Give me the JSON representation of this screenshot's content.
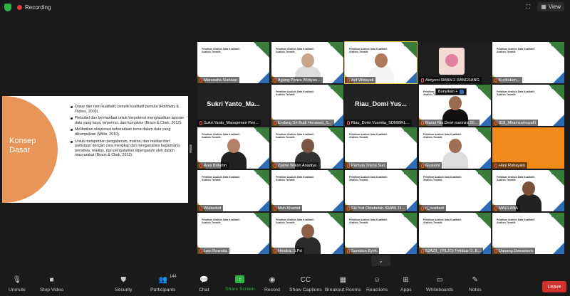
{
  "topbar": {
    "recording": "Recording",
    "view": "View"
  },
  "presentation": {
    "title_line1": "Konsep",
    "title_line2": "Dasar",
    "bullets": [
      "Dasar dari riset kualitatif, peneliti kualitatif pemula (Holloway & Todres, 2003).",
      "Fleksibel dan bermanfaat untuk berpotensi menghasilkan laporan data yang kaya, terperinci, dan kompleks (Braun & Clark, 2012).",
      "Melibatkan eksplorasi keberadaan tema dalam data yang dikumpulkan (Willis, 2010).",
      "Untuk melaporkan pengalaman, makna, dan realitas dari partisipan dengan cara mengkaji dan menganalisis bagaimana peristiwa, realitas, dan pengalaman dipengaruhi oleh dalam masyarakat (Braun & Clark, 2012)."
    ]
  },
  "slide_thumb": {
    "title1": "Pelatihan Analisis Data Kualitatif:",
    "title2": "Analisis Tematik"
  },
  "participants_tiles": [
    "Marusaha Siahaan",
    "Agung Purwa Widiyan...",
    "Arif Widayati",
    "Asriyeni SMAN 2 RANGSANG",
    "Kurikulum...",
    "Sukri Yanto_Manajemen Pen...",
    "Endang Sri Budi Herawati_S...",
    "Riau_Domi Yusmita_SDN09KL...",
    "Marini Ria Dewi marinira.20...",
    "018_Mhamzamuyaffi",
    "Ares Brilartin",
    "Zakhir Wikan Anadiya",
    "Pamula Trisna Suri",
    "Gusiaini",
    "Hani Rohayani",
    "Widiastuti",
    "Muh Khamid",
    "Siti Yuli Oktabelah-SMAN 11...",
    "ri_rusdiadi",
    "MAULANA",
    "Leni Rosmita",
    "Hendra, S.Pd",
    "Sumisun Eyek",
    "52A23_ (FILJO) Felidius O. B...",
    "Danang Dewantoro"
  ],
  "big_names": {
    "sukri": "Sukri Yanto_Ma...",
    "riau": "Riau_Domi Yus..."
  },
  "tooltip": "Bunyikan +",
  "toolbar": {
    "unmute": "Unmute",
    "stop_video": "Stop Video",
    "security": "Security",
    "participants": "Participants",
    "participants_count": "144",
    "chat": "Chat",
    "share_screen": "Share Screen",
    "record": "Record",
    "show_captions": "Show Captions",
    "breakout_rooms": "Breakout Rooms",
    "reactions": "Reactions",
    "apps": "Apps",
    "whiteboards": "Whiteboards",
    "notes": "Notes",
    "leave": "Leave"
  }
}
